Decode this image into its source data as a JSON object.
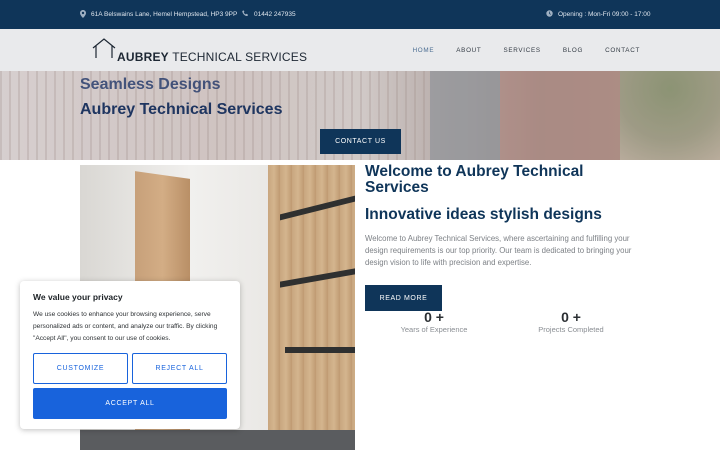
{
  "topbar": {
    "address": "61A Belswains Lane, Hemel Hempstead, HP3 9PP",
    "phone": "01442 247935",
    "hours": "Opening : Mon-Fri 09:00 - 17:00",
    "icons": [
      "location-pin-icon",
      "phone-icon",
      "clock-icon"
    ]
  },
  "header": {
    "logo_bold": "AUBREY",
    "logo_rest": " TECHNICAL SERVICES",
    "nav": [
      "HOME",
      "ABOUT",
      "SERVICES",
      "BLOG",
      "CONTACT"
    ],
    "active_nav": "HOME"
  },
  "hero": {
    "title_line1": "Seamless Designs",
    "title_line2": "Aubrey Technical Services",
    "button_label": "CONTACT US"
  },
  "content": {
    "welcome": "Welcome to Aubrey Technical Services",
    "tagline": "Innovative ideas stylish designs",
    "paragraph": "Welcome to Aubrey Technical Services, where ascertaining and fulfilling your design requirements is our top priority. Our team is dedicated to bringing your design vision to life with precision and expertise.",
    "read_more": "READ MORE",
    "stats": [
      {
        "value": "0 +",
        "label": "Years of Experience"
      },
      {
        "value": "0 +",
        "label": "Projects Completed"
      }
    ]
  },
  "cookie": {
    "title": "We value your privacy",
    "text": "We use cookies to enhance your browsing experience, serve personalized ads or content, and analyze our traffic. By clicking \"Accept All\", you consent to our use of cookies.",
    "customize": "CUSTOMIZE",
    "reject": "REJECT ALL",
    "accept": "ACCEPT ALL"
  },
  "colors": {
    "brand_navy": "#0f3559",
    "cookie_blue": "#1863dc",
    "header_bg": "#e9eaec"
  }
}
